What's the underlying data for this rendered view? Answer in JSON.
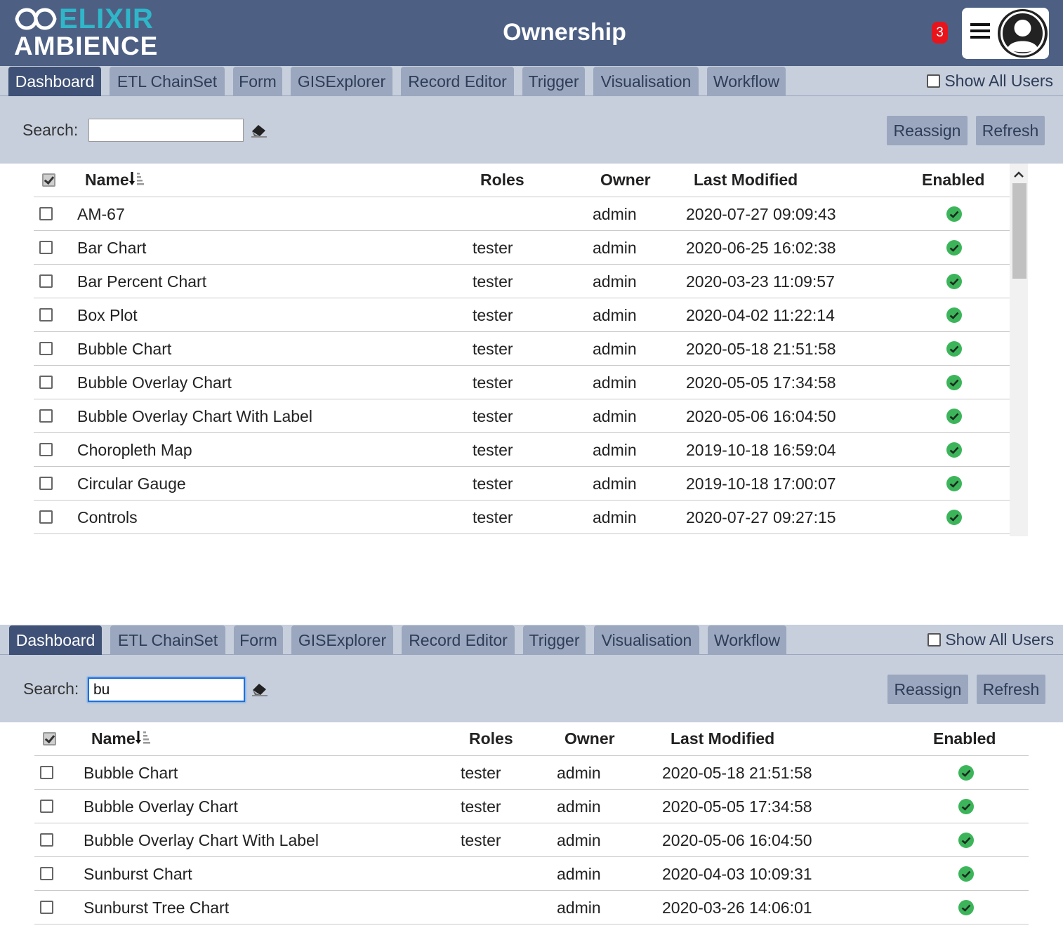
{
  "header": {
    "logo_top": "ELIXIR",
    "logo_bottom": "AMBIENCE",
    "title": "Ownership",
    "notification_count": "3",
    "menu_icon": "hamburger-icon",
    "avatar_icon": "user-avatar-icon"
  },
  "colors": {
    "header_bg": "#4d6084",
    "logo_accent": "#2fb7c9",
    "tab_active": "#3f5176",
    "tab_inactive": "#9ba7be",
    "panel_bg": "#c7cfdd",
    "badge": "#e8141c",
    "enabled_check": "#3cb55a"
  },
  "panel1": {
    "tabs": [
      {
        "label": "Dashboard",
        "active": true
      },
      {
        "label": "ETL ChainSet",
        "active": false
      },
      {
        "label": "Form",
        "active": false
      },
      {
        "label": "GISExplorer",
        "active": false
      },
      {
        "label": "Record Editor",
        "active": false
      },
      {
        "label": "Trigger",
        "active": false
      },
      {
        "label": "Visualisation",
        "active": false
      },
      {
        "label": "Workflow",
        "active": false
      }
    ],
    "show_all_users": "Show All Users",
    "search_label": "Search:",
    "search_value": "",
    "reassign": "Reassign",
    "refresh": "Refresh",
    "columns": {
      "name": "Name",
      "roles": "Roles",
      "owner": "Owner",
      "last_modified": "Last Modified",
      "enabled": "Enabled"
    },
    "rows": [
      {
        "name": "AM-67",
        "roles": "",
        "owner": "admin",
        "modified": "2020-07-27 09:09:43",
        "enabled": true
      },
      {
        "name": "Bar Chart",
        "roles": "tester",
        "owner": "admin",
        "modified": "2020-06-25 16:02:38",
        "enabled": true
      },
      {
        "name": "Bar Percent Chart",
        "roles": "tester",
        "owner": "admin",
        "modified": "2020-03-23 11:09:57",
        "enabled": true
      },
      {
        "name": "Box Plot",
        "roles": "tester",
        "owner": "admin",
        "modified": "2020-04-02 11:22:14",
        "enabled": true
      },
      {
        "name": "Bubble Chart",
        "roles": "tester",
        "owner": "admin",
        "modified": "2020-05-18 21:51:58",
        "enabled": true
      },
      {
        "name": "Bubble Overlay Chart",
        "roles": "tester",
        "owner": "admin",
        "modified": "2020-05-05 17:34:58",
        "enabled": true
      },
      {
        "name": "Bubble Overlay Chart With Label",
        "roles": "tester",
        "owner": "admin",
        "modified": "2020-05-06 16:04:50",
        "enabled": true
      },
      {
        "name": "Choropleth Map",
        "roles": "tester",
        "owner": "admin",
        "modified": "2019-10-18 16:59:04",
        "enabled": true
      },
      {
        "name": "Circular Gauge",
        "roles": "tester",
        "owner": "admin",
        "modified": "2019-10-18 17:00:07",
        "enabled": true
      },
      {
        "name": "Controls",
        "roles": "tester",
        "owner": "admin",
        "modified": "2020-07-27 09:27:15",
        "enabled": true
      }
    ]
  },
  "panel2": {
    "tabs": [
      {
        "label": "Dashboard",
        "active": true
      },
      {
        "label": "ETL ChainSet",
        "active": false
      },
      {
        "label": "Form",
        "active": false
      },
      {
        "label": "GISExplorer",
        "active": false
      },
      {
        "label": "Record Editor",
        "active": false
      },
      {
        "label": "Trigger",
        "active": false
      },
      {
        "label": "Visualisation",
        "active": false
      },
      {
        "label": "Workflow",
        "active": false
      }
    ],
    "show_all_users": "Show All Users",
    "search_label": "Search:",
    "search_value": "bu",
    "reassign": "Reassign",
    "refresh": "Refresh",
    "columns": {
      "name": "Name",
      "roles": "Roles",
      "owner": "Owner",
      "last_modified": "Last Modified",
      "enabled": "Enabled"
    },
    "rows": [
      {
        "name": "Bubble Chart",
        "roles": "tester",
        "owner": "admin",
        "modified": "2020-05-18 21:51:58",
        "enabled": true
      },
      {
        "name": "Bubble Overlay Chart",
        "roles": "tester",
        "owner": "admin",
        "modified": "2020-05-05 17:34:58",
        "enabled": true
      },
      {
        "name": "Bubble Overlay Chart With Label",
        "roles": "tester",
        "owner": "admin",
        "modified": "2020-05-06 16:04:50",
        "enabled": true
      },
      {
        "name": "Sunburst Chart",
        "roles": "",
        "owner": "admin",
        "modified": "2020-04-03 10:09:31",
        "enabled": true
      },
      {
        "name": "Sunburst Tree Chart",
        "roles": "",
        "owner": "admin",
        "modified": "2020-03-26 14:06:01",
        "enabled": true
      }
    ]
  }
}
